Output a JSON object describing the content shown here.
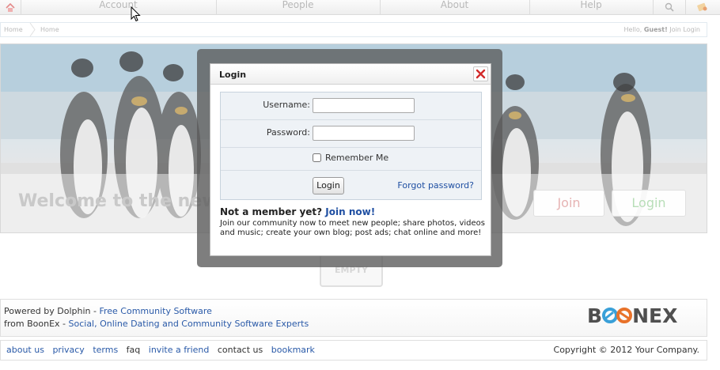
{
  "nav": {
    "tabs": [
      "Account",
      "People",
      "About",
      "Help"
    ],
    "icons": [
      "home-icon",
      "search-icon",
      "bookmark-icon"
    ]
  },
  "breadcrumb": {
    "items": [
      "Home",
      "Home"
    ],
    "greeting_prefix": "Hello, ",
    "greeting_user": "Guest!",
    "greeting_link": "Join Login"
  },
  "hero": {
    "welcome": "Welcome to the new",
    "join_label": "Join",
    "login_label": "Login",
    "join_color": "#e6b3b3",
    "login_color": "#b8deb8"
  },
  "empty_label": "EMPTY",
  "modal": {
    "title": "Login",
    "username_label": "Username:",
    "password_label": "Password:",
    "username_value": "",
    "password_value": "",
    "remember_label": "Remember Me",
    "remember_checked": false,
    "login_button": "Login",
    "forgot_link": "Forgot password?",
    "not_member": "Not a member yet?",
    "join_now": "Join now!",
    "description": "Join our community now to meet new people; share photos, videos and music; create your own blog; post ads; chat online and more!"
  },
  "footer": {
    "line1_prefix": "Powered by Dolphin - ",
    "line1_link": "Free Community Software",
    "line2_prefix": "from BoonEx - ",
    "line2_link": "Social, Online Dating and Community Software Experts",
    "logo_left": "B",
    "logo_right": "NEX",
    "links": [
      "about us",
      "privacy",
      "terms",
      "faq",
      "invite a friend",
      "contact us",
      "bookmark"
    ],
    "copyright": "Copyright © 2012 Your Company.",
    "link_color": "#2a5aa8"
  }
}
